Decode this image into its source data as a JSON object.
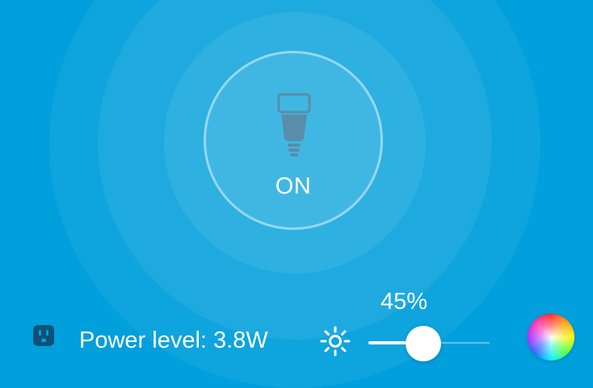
{
  "theme": {
    "background": "#019fdc",
    "bulb_icon_color": "#5a8daa",
    "outlet_icon_color": "#0b5276",
    "foreground": "#ffffff"
  },
  "power": {
    "state_label": "ON",
    "icon": "light-bulb-icon"
  },
  "status": {
    "power_level_text": "Power level: 3.8W",
    "icon": "power-outlet-icon"
  },
  "brightness": {
    "value_label": "45%",
    "value": 45,
    "max": 100,
    "icon": "brightness-sun-icon"
  },
  "color_picker": {
    "icon": "color-wheel-icon"
  }
}
